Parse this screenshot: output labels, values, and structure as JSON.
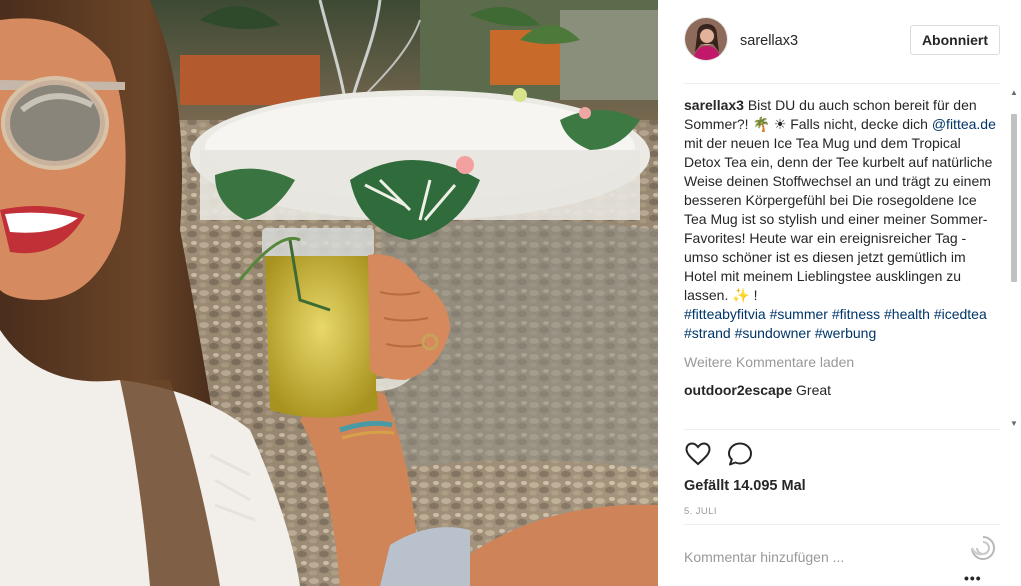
{
  "photo": {
    "label": "fitvia"
  },
  "post": {
    "username": "sarellax3",
    "follow_label": "Abonniert",
    "caption": {
      "user": "sarellax3",
      "text_1": "Bist DU du auch schon bereit für den Sommer?! 🌴 ☀ Falls nicht, decke dich ",
      "mention": "@fittea.de",
      "text_2": " mit der neuen Ice Tea Mug und dem Tropical Detox Tea ein, denn der Tee kurbelt auf natürliche Weise deinen Stoffwechsel an und trägt zu einem besseren Körpergefühl bei Die rosegoldene Ice Tea Mug ist so stylish und einer meiner Sommer-Favorites! Heute war ein ereignisreicher Tag - umso schöner ist es diesen jetzt gemütlich im Hotel mit meinem Lieblingstee ausklingen zu lassen. ✨ !"
    },
    "hashtags": [
      "#fitteabyfitvia",
      "#summer",
      "#fitness",
      "#health",
      "#icedtea",
      "#strand",
      "#sundowner",
      "#werbung"
    ],
    "load_more": "Weitere Kommentare laden",
    "reply": {
      "user": "outdoor2escape",
      "text": "Great"
    },
    "likes": "Gefällt 14.095 Mal",
    "date": "5. JULI",
    "comment_placeholder": "Kommentar hinzufügen ...",
    "more_label": "•••"
  },
  "icons": {
    "like": "heart-icon",
    "comment": "comment-bubble-icon",
    "more": "ellipsis-icon"
  },
  "colors": {
    "link": "#003569",
    "muted": "#999999",
    "text": "#262626",
    "border": "#dbdbdb"
  }
}
